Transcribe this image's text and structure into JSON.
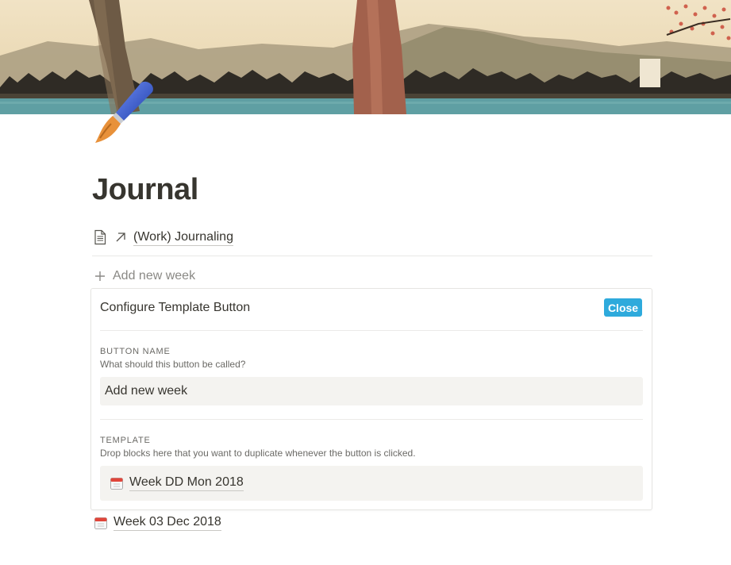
{
  "page": {
    "title": "Journal"
  },
  "cover": {
    "description": "Japanese woodblock landscape with tree trunks, mountains, village and water"
  },
  "page_icon": {
    "icon": "paintbrush-icon"
  },
  "linked_page": {
    "icon": "document-icon",
    "link_icon": "arrow-up-right-icon",
    "title": "(Work) Journaling"
  },
  "add_button": {
    "icon": "plus-icon",
    "label": "Add new week"
  },
  "config_panel": {
    "title": "Configure Template Button",
    "close_label": "Close",
    "close_color": "#2eaadc",
    "button_name": {
      "label": "BUTTON NAME",
      "help": "What should this button be called?",
      "value": "Add new week"
    },
    "template": {
      "label": "TEMPLATE",
      "help": "Drop blocks here that you want to duplicate whenever the button is clicked.",
      "block": {
        "icon": "calendar-icon",
        "title": "Week DD Mon 2018"
      }
    }
  },
  "entries": [
    {
      "icon": "calendar-icon",
      "title": "Week 03 Dec 2018"
    }
  ]
}
